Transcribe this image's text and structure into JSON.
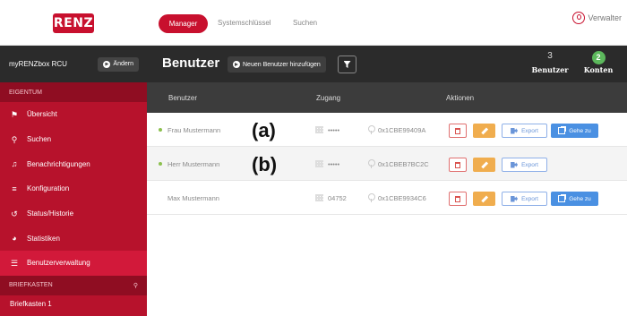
{
  "topbar": {
    "logo_text": "RENZ",
    "nav": [
      {
        "label": "Manager",
        "active": true
      },
      {
        "label": "Systemschlüssel",
        "active": false
      },
      {
        "label": "Suchen",
        "active": false
      }
    ],
    "user_label": "Verwalter"
  },
  "sidebar": {
    "box_name": "myRENZbox RCU",
    "change_label": "Ändern",
    "section_property": "EIGENTUM",
    "items": [
      {
        "label": "Übersicht",
        "icon": "flag-icon"
      },
      {
        "label": "Suchen",
        "icon": "search-icon"
      },
      {
        "label": "Benachrichtigungen",
        "icon": "bell-icon"
      },
      {
        "label": "Konfiguration",
        "icon": "sliders-icon"
      },
      {
        "label": "Status/Historie",
        "icon": "history-icon"
      },
      {
        "label": "Statistiken",
        "icon": "pie-chart-icon"
      },
      {
        "label": "Benutzerverwaltung",
        "icon": "list-icon",
        "active": true
      }
    ],
    "section_mailbox": "BRIEFKASTEN",
    "mailbox_item": "Briefkasten 1"
  },
  "header": {
    "title": "Benutzer",
    "add_user_label": "Neuen Benutzer hinzufügen",
    "stats": [
      {
        "value": "3",
        "label": "Benutzer"
      },
      {
        "value": "2",
        "label": "Konten"
      }
    ]
  },
  "table": {
    "columns": [
      "Benutzer",
      "Zugang",
      "Aktionen"
    ],
    "rows": [
      {
        "name": "Frau Mustermann",
        "active": true,
        "pin": "•••••",
        "key": "0x1CBE99409A",
        "export": "Export",
        "goto": "Gehe zu",
        "callout": "(a)"
      },
      {
        "name": "Herr Mustermann",
        "active": true,
        "pin": "•••••",
        "key": "0x1CBEB7BC2C",
        "export": "Export",
        "goto": null,
        "callout": "(b)"
      },
      {
        "name": "Max Mustermann",
        "active": false,
        "pin": "04752",
        "key": "0x1CBE9934C6",
        "export": "Export",
        "goto": "Gehe zu",
        "callout": null
      }
    ]
  },
  "colors": {
    "brand_red": "#c8102e",
    "sidebar_red": "#b7122c",
    "active_red": "#d2193a",
    "header_dark": "#2b2b2b",
    "success_green": "#5cb85c",
    "edit_orange": "#f0ad4e",
    "goto_blue": "#4a90e2"
  }
}
